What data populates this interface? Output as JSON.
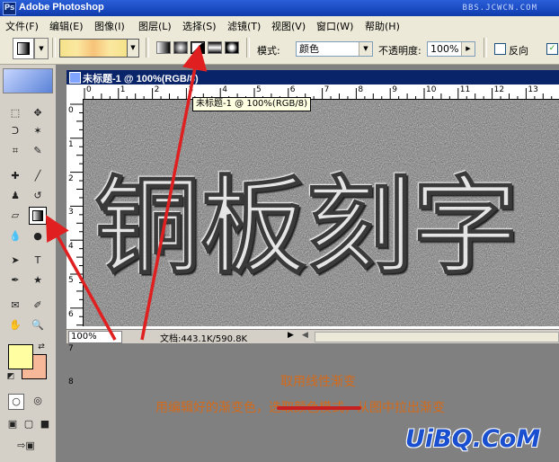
{
  "app": {
    "title": "Adobe Photoshop",
    "watermark": "BBS.JCWCN.COM"
  },
  "menu": [
    "文件(F)",
    "编辑(E)",
    "图像(I)",
    "图层(L)",
    "选择(S)",
    "滤镜(T)",
    "视图(V)",
    "窗口(W)",
    "帮助(H)"
  ],
  "options": {
    "mode_label": "模式:",
    "mode_value": "颜色",
    "opacity_label": "不透明度:",
    "opacity_value": "100%",
    "reverse_label": "反向"
  },
  "document": {
    "title": "未标题-1 @ 100%(RGB/8)",
    "tooltip": "未标题-1 @ 100%(RGB/8)",
    "zoom": "100%",
    "doc_info": "文档:443.1K/590.8K",
    "canvas_text": "铜板刻字",
    "ruler_h": [
      "0",
      "1",
      "2",
      "3",
      "4",
      "5",
      "6",
      "7",
      "8",
      "9",
      "10",
      "11",
      "12",
      "13"
    ],
    "ruler_v": [
      "0",
      "1",
      "2",
      "3",
      "4",
      "5",
      "6",
      "7",
      "8"
    ]
  },
  "annotation": {
    "line1": "取用线性渐变",
    "line2": "用编辑好的渐变色，选取颜色模式，从图中拉出渐变"
  },
  "site_logo": "UiBQ.CoM",
  "colors": {
    "foreground": "#fffea0",
    "background": "#f7b89a",
    "arrow": "#e02020",
    "annotation": "#d46a1a"
  }
}
